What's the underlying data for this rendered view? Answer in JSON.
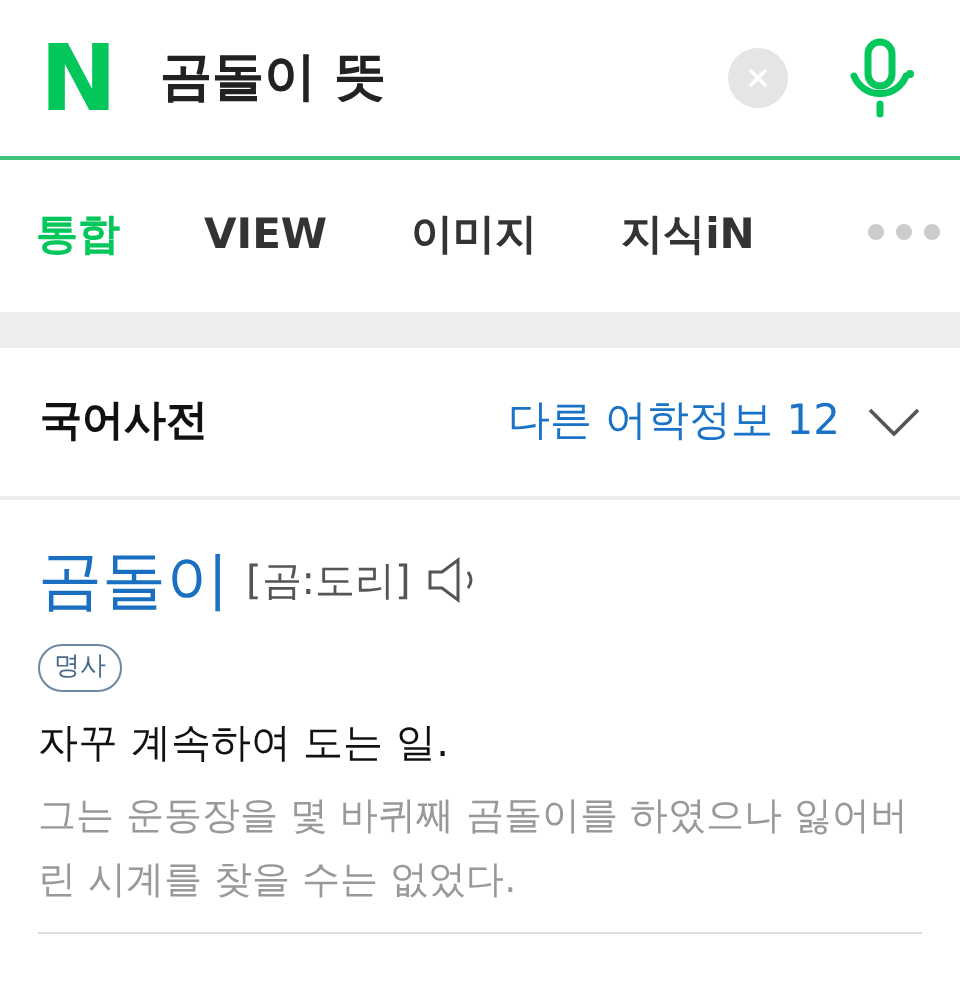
{
  "search": {
    "logo": "N",
    "query": "곰돌이 뜻"
  },
  "tabs": [
    {
      "label": "통합",
      "selected": true
    },
    {
      "label": "VIEW",
      "selected": false
    },
    {
      "label": "이미지",
      "selected": false
    },
    {
      "label": "지식iN",
      "selected": false
    }
  ],
  "dictionary": {
    "title": "국어사전",
    "more_link": "다른 어학정보 12",
    "entry": {
      "word": "곰돌이",
      "pronunciation": "[곰:도리]",
      "part_of_speech": "명사",
      "definition": "자꾸 계속하여 도는 일.",
      "example": "그는 운동장을 몇 바퀴째 곰돌이를 하였으나 잃어버린 시계를 찾을 수는 없었다."
    }
  }
}
